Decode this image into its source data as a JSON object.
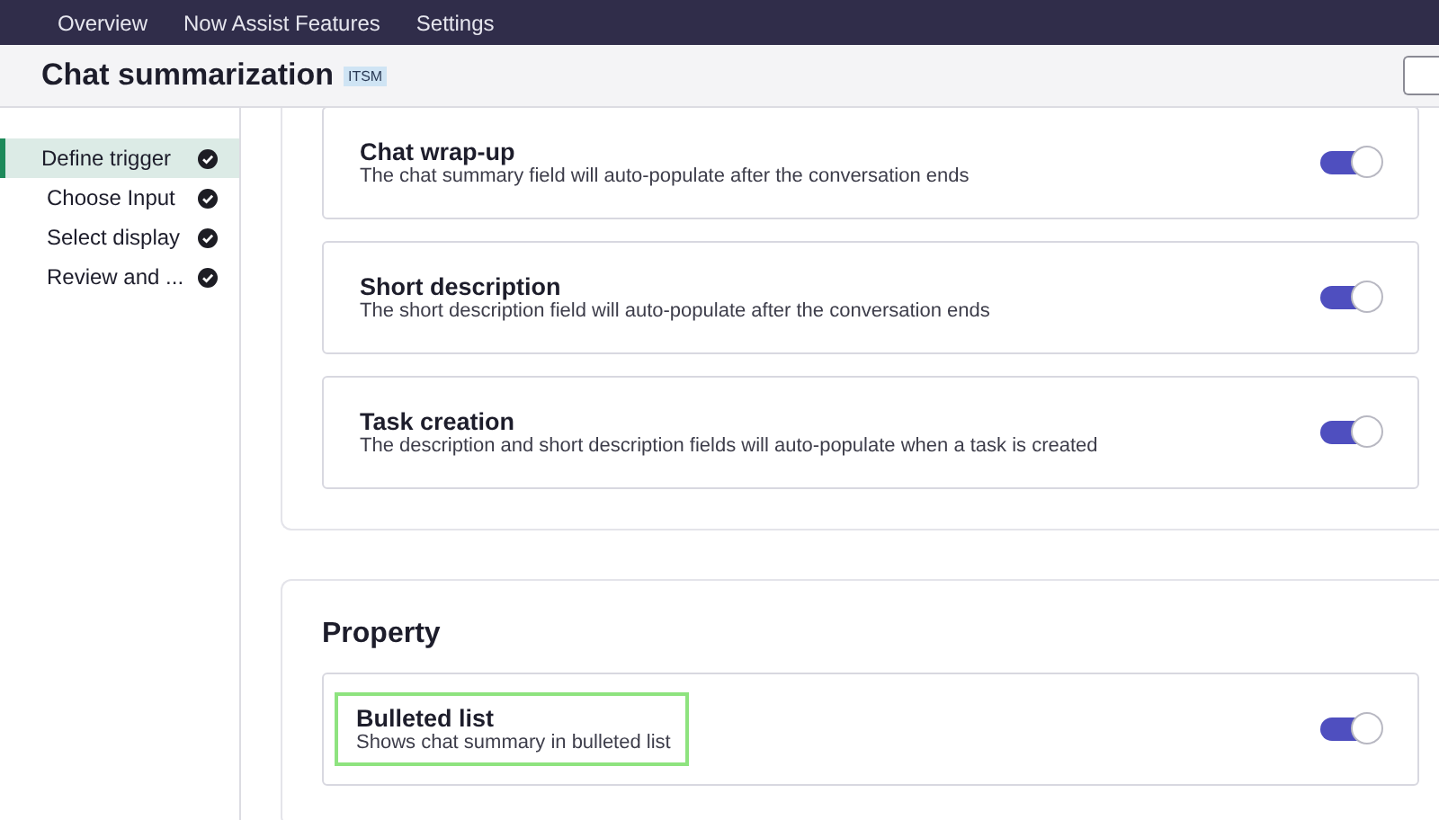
{
  "nav": {
    "items": [
      {
        "label": "Overview"
      },
      {
        "label": "Now Assist Features"
      },
      {
        "label": "Settings"
      }
    ]
  },
  "header": {
    "title": "Chat summarization",
    "badge": "ITSM"
  },
  "steps": [
    {
      "label": "Define trigger",
      "selected": true,
      "done": true
    },
    {
      "label": "Choose Input",
      "selected": false,
      "done": true
    },
    {
      "label": "Select display",
      "selected": false,
      "done": true
    },
    {
      "label": "Review and ...",
      "selected": false,
      "done": true
    }
  ],
  "sections": [
    {
      "items": [
        {
          "title": "Chat wrap-up",
          "description": "The chat summary field will auto-populate after the conversation ends",
          "on": true,
          "highlighted": false
        },
        {
          "title": "Short description",
          "description": "The short description field will auto-populate after the conversation ends",
          "on": true,
          "highlighted": false
        },
        {
          "title": "Task creation",
          "description": "The description and short description fields will auto-populate when a task is created",
          "on": true,
          "highlighted": false
        }
      ]
    },
    {
      "heading": "Property",
      "items": [
        {
          "title": "Bulleted list",
          "description": "Shows chat summary in bulleted list",
          "on": true,
          "highlighted": true
        }
      ]
    }
  ]
}
